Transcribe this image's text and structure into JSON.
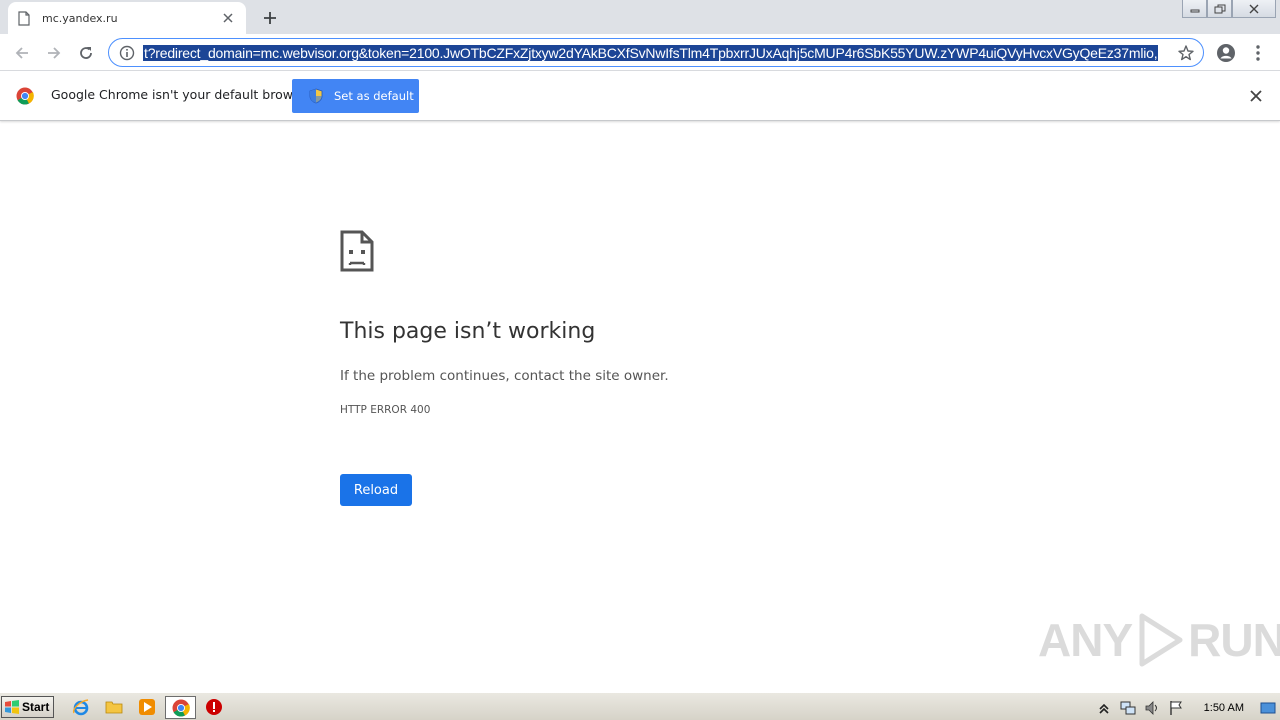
{
  "tab": {
    "title": "mc.yandex.ru",
    "icon": "page-icon"
  },
  "toolbar": {
    "url": "t?redirect_domain=mc.webvisor.org&token=2100.JwOTbCZFxZjtxyw2dYAkBCXfSvNwIfsTlm4TpbxrrJUxAqhj5cMUP4r6SbK55YUW.zYWP4uiQVyHvcxVGyQeEz37mlio,"
  },
  "infobar": {
    "message": "Google Chrome isn't your default browser",
    "button_label": "Set as default"
  },
  "error": {
    "title": "This page isn’t working",
    "message": "If the problem continues, contact the site owner.",
    "code": "HTTP ERROR 400",
    "reload_label": "Reload"
  },
  "watermark": {
    "left": "ANY",
    "right": "RUN"
  },
  "taskbar": {
    "start_label": "Start",
    "clock": "1:50 AM"
  },
  "colors": {
    "accent": "#1a73e8",
    "infobar_button": "#4285f4",
    "selection": "#1c4596"
  }
}
